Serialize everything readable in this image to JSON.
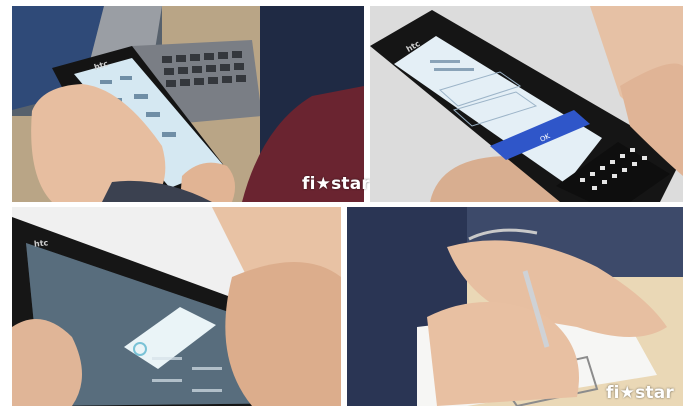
{
  "logo": {
    "text": "fi★star"
  },
  "phone": {
    "brand": "htc"
  },
  "screen2": {
    "ok_label": "OK"
  },
  "palette": {
    "screen_blue": "#cfe3f0",
    "button_blue": "#2f56c9",
    "phone_black": "#151515",
    "skin": "#e9c3a6"
  }
}
